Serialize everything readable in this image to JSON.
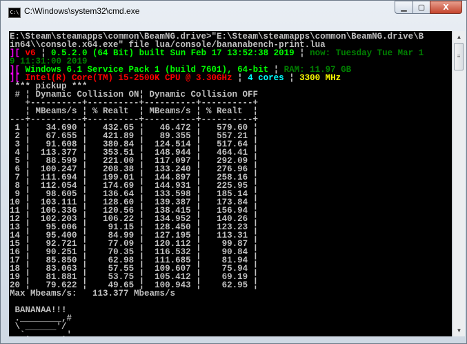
{
  "window": {
    "title": "C:\\Windows\\system32\\cmd.exe",
    "icon_text": "C:\\",
    "min": "▁",
    "max": "▢",
    "close": "X"
  },
  "colors": {
    "white": "#c0c0c0",
    "magenta": "#ff00ff",
    "red": "#ff0000",
    "green": "#00ff00",
    "dkgreen": "#008000",
    "cyan": "#00ffff",
    "yellow": "#ffff00"
  },
  "header_lines": [
    [
      {
        "t": "E:\\Steam\\steamapps\\common\\BeamNG.drive>\"E:\\Steam\\steamapps\\common\\BeamNG.drive\\B",
        "c": "white"
      }
    ],
    [
      {
        "t": "in64\\\\console.x64.exe\" file lua/console/bananabench-print.lua",
        "c": "white"
      }
    ],
    [
      {
        "t": "][ ",
        "c": "magenta"
      },
      {
        "t": "v6",
        "c": "red"
      },
      {
        "t": " ¦ ",
        "c": "white"
      },
      {
        "t": "0.5.2.0 (64 Bit) built Sun Feb 17 13:52:38 2019",
        "c": "green"
      },
      {
        "t": " ¦ ",
        "c": "white"
      },
      {
        "t": "now: Tuesday Tue Mar 1",
        "c": "dkgreen"
      }
    ],
    [
      {
        "t": "9 11:31:00 2019",
        "c": "dkgreen"
      }
    ],
    [
      {
        "t": "][ ",
        "c": "magenta"
      },
      {
        "t": "Windows 6.1 Service Pack 1 (build 7601), 64-bit",
        "c": "green"
      },
      {
        "t": " ¦ ",
        "c": "white"
      },
      {
        "t": "RAM: 11.97 GB",
        "c": "dkgreen"
      }
    ],
    [
      {
        "t": "][ ",
        "c": "magenta"
      },
      {
        "t": "Intel(R) Core(TM) i5-2500K CPU @ 3.30GHz",
        "c": "red"
      },
      {
        "t": " ¦ ",
        "c": "white"
      },
      {
        "t": "4 cores",
        "c": "cyan"
      },
      {
        "t": " ¦ ",
        "c": "white"
      },
      {
        "t": "3300 MHz",
        "c": "yellow"
      }
    ],
    [
      {
        "t": " *** pickup ***",
        "c": "white"
      }
    ],
    [
      {
        "t": " # ¦ Dynamic Collision ON¦ Dynamic Collision OFF",
        "c": "white"
      }
    ],
    [
      {
        "t": "   +----------+----------+----------+----------+",
        "c": "white"
      }
    ],
    [
      {
        "t": "   ¦ MBeams/s ¦ % Realt  ¦ MBeams/s ¦ % Realt  ¦",
        "c": "white"
      }
    ],
    [
      {
        "t": "---+----------+----------+----------+----------+",
        "c": "white"
      }
    ]
  ],
  "table_rows": [
    [
      "1",
      "34.690",
      "432.65",
      "46.472",
      "579.60"
    ],
    [
      "2",
      "67.655",
      "421.89",
      "89.355",
      "557.21"
    ],
    [
      "3",
      "91.608",
      "380.84",
      "124.514",
      "517.64"
    ],
    [
      "4",
      "113.377",
      "353.51",
      "148.944",
      "464.41"
    ],
    [
      "5",
      "88.599",
      "221.00",
      "117.097",
      "292.09"
    ],
    [
      "6",
      "100.247",
      "208.38",
      "133.240",
      "276.96"
    ],
    [
      "7",
      "111.694",
      "199.01",
      "144.897",
      "258.16"
    ],
    [
      "8",
      "112.054",
      "174.69",
      "144.931",
      "225.95"
    ],
    [
      "9",
      "98.605",
      "136.64",
      "133.598",
      "185.14"
    ],
    [
      "10",
      "103.111",
      "128.60",
      "139.387",
      "173.84"
    ],
    [
      "11",
      "106.336",
      "120.56",
      "138.415",
      "156.94"
    ],
    [
      "12",
      "102.203",
      "106.22",
      "134.952",
      "140.26"
    ],
    [
      "13",
      "95.006",
      "91.15",
      "128.450",
      "123.23"
    ],
    [
      "14",
      "95.400",
      "84.99",
      "127.195",
      "113.31"
    ],
    [
      "15",
      "92.721",
      "77.09",
      "120.112",
      "99.87"
    ],
    [
      "16",
      "90.251",
      "70.35",
      "116.532",
      "90.84"
    ],
    [
      "17",
      "85.850",
      "62.98",
      "111.685",
      "81.94"
    ],
    [
      "18",
      "83.063",
      "57.55",
      "109.607",
      "75.94"
    ],
    [
      "19",
      "81.881",
      "53.75",
      "105.412",
      "69.19"
    ],
    [
      "20",
      "79.622",
      "49.65",
      "100.943",
      "62.95"
    ]
  ],
  "footer_lines": [
    "Max Mbeams/s:   113.377 Mbeams/s",
    "",
    " BANANAA!!!",
    " .________,#",
    " \\ ______'/",
    "  `.______,'"
  ]
}
